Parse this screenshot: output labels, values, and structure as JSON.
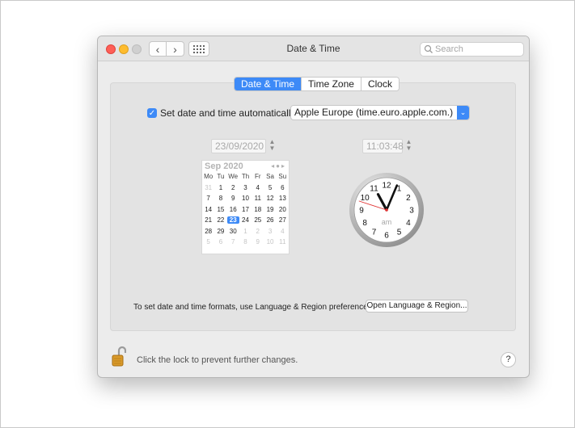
{
  "window": {
    "title": "Date & Time"
  },
  "search": {
    "placeholder": "Search"
  },
  "tabs": [
    {
      "label": "Date & Time",
      "active": true
    },
    {
      "label": "Time Zone",
      "active": false
    },
    {
      "label": "Clock",
      "active": false
    }
  ],
  "auto": {
    "checked": true,
    "label": "Set date and time automatically:",
    "server": "Apple Europe (time.euro.apple.com.)"
  },
  "date_field": {
    "value": "23/09/2020"
  },
  "time_field": {
    "value": "11:03:48"
  },
  "calendar": {
    "month_label": "Sep 2020",
    "weekdays": [
      "Mo",
      "Tu",
      "We",
      "Th",
      "Fr",
      "Sa",
      "Su"
    ],
    "weeks": [
      [
        "31",
        "1",
        "2",
        "3",
        "4",
        "5",
        "6"
      ],
      [
        "7",
        "8",
        "9",
        "10",
        "11",
        "12",
        "13"
      ],
      [
        "14",
        "15",
        "16",
        "17",
        "18",
        "19",
        "20"
      ],
      [
        "21",
        "22",
        "23",
        "24",
        "25",
        "26",
        "27"
      ],
      [
        "28",
        "29",
        "30",
        "1",
        "2",
        "3",
        "4"
      ],
      [
        "5",
        "6",
        "7",
        "8",
        "9",
        "10",
        "11"
      ]
    ],
    "selected": "23"
  },
  "clock": {
    "numbers": [
      "12",
      "1",
      "2",
      "3",
      "4",
      "5",
      "6",
      "7",
      "8",
      "9",
      "10",
      "11"
    ],
    "ampm": "am",
    "time": {
      "hour": 11,
      "minute": 3,
      "second": 48
    }
  },
  "footer": {
    "formats_text": "To set date and time formats, use Language & Region preferences.",
    "open_button": "Open Language & Region...",
    "lock_text": "Click the lock to prevent further changes.",
    "help_label": "?"
  },
  "colors": {
    "accent": "#3d8af7",
    "second_hand": "#e03030"
  }
}
